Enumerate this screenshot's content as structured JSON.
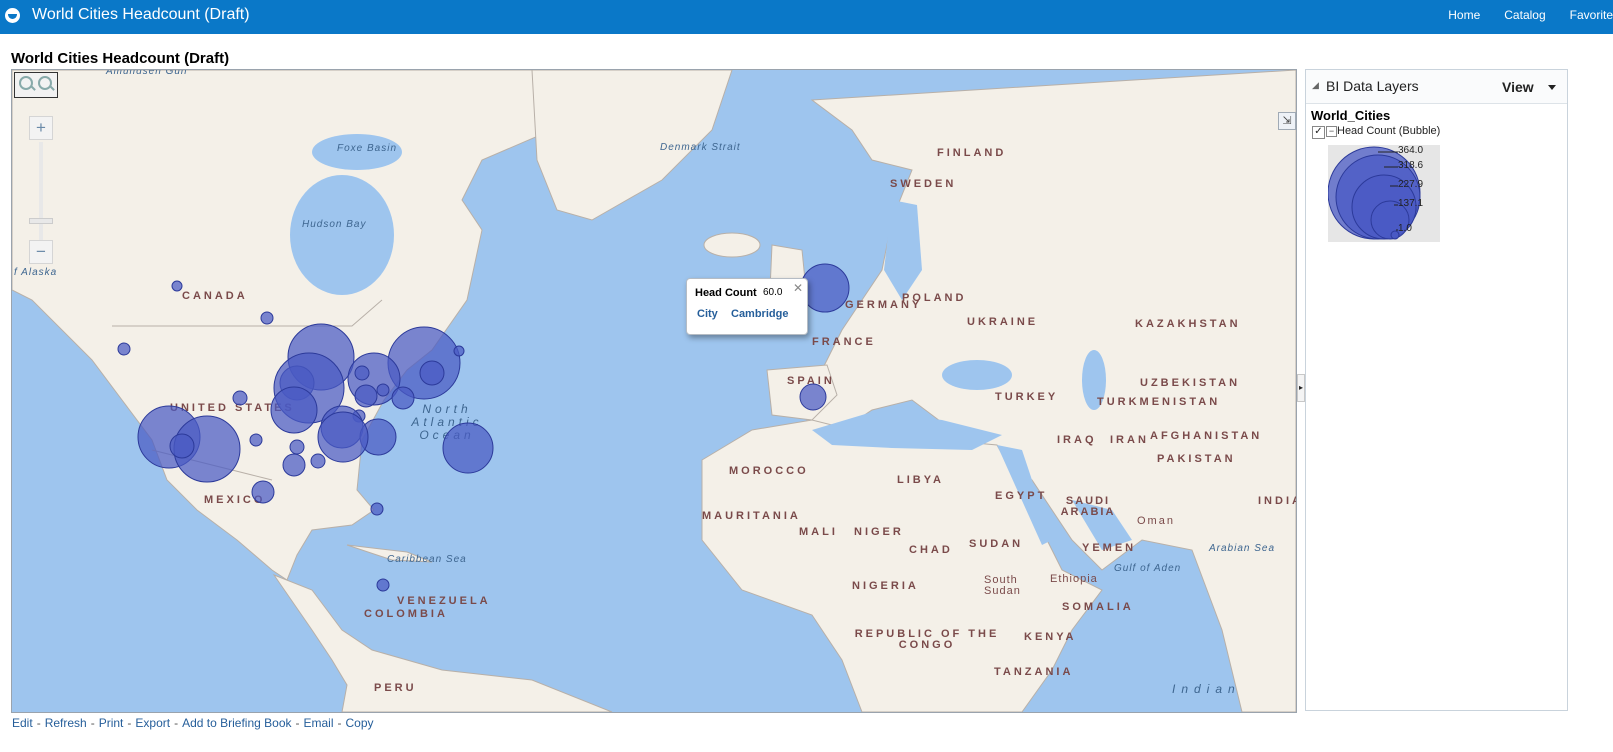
{
  "header": {
    "app_title": "World Cities Headcount (Draft)",
    "nav": [
      "Home",
      "Catalog",
      "Favorite"
    ]
  },
  "page": {
    "title": "World Cities Headcount (Draft)"
  },
  "map": {
    "labels": {
      "canada": "CANADA",
      "usa": "UNITED STATES",
      "mexico": "MEXICO",
      "venezuela": "VENEZUELA",
      "colombia": "COLOMBIA",
      "peru": "PERU",
      "finland": "FINLAND",
      "sweden": "SWEDEN",
      "poland": "POLAND",
      "germany": "GERMANY",
      "france": "FRANCE",
      "ukraine": "UKRAINE",
      "spain": "SPAIN",
      "kazakhstan": "KAZAKHSTAN",
      "uzbekistan": "UZBEKISTAN",
      "turkmenistan": "TURKMENISTAN",
      "turkey": "TURKEY",
      "iraq": "IRAQ",
      "iran": "IRAN",
      "afghanistan": "AFGHANISTAN",
      "pakistan": "PAKISTAN",
      "india": "INDIA",
      "morocco": "MOROCCO",
      "libya": "LIBYA",
      "egypt": "EGYPT",
      "saudi": "SAUDI ARABIA",
      "oman": "Oman",
      "yemen": "YEMEN",
      "mauritania": "MAURITANIA",
      "mali": "MALI",
      "niger": "NIGER",
      "chad": "CHAD",
      "sudan": "SUDAN",
      "south_sudan": "South Sudan",
      "ethiopia": "Ethiopia",
      "somalia": "SOMALIA",
      "nigeria": "NIGERIA",
      "kenya": "KENYA",
      "congo": "REPUBLIC OF THE CONGO",
      "tanzania": "TANZANIA",
      "hudson": "Hudson Bay",
      "foxe": "Foxe Basin",
      "denmark": "Denmark Strait",
      "north_atlantic": "North Atlantic Ocean",
      "caribbean": "Caribbean Sea",
      "arabian": "Arabian Sea",
      "aden": "Gulf of Aden",
      "indian": "Indian",
      "alaska": "f Alaska",
      "amundsen": "Amundsen Gulf"
    },
    "zoom_in_symbol": "+",
    "zoom_out_symbol": "−",
    "overview_symbol": "⇲",
    "tooltip": {
      "measure_label": "Head Count",
      "measure_value": "60.0",
      "city_label": "City",
      "city_value": "Cambridge",
      "close_symbol": "✕"
    }
  },
  "layers_panel": {
    "title": "BI Data Layers",
    "view_label": "View",
    "layer_name": "World_Cities",
    "layer_item": "Head Count (Bubble)",
    "checked": true,
    "legend_values": [
      "364.0",
      "318.6",
      "227.9",
      "137.1",
      "1.0"
    ]
  },
  "footer": {
    "links": [
      "Edit",
      "Refresh",
      "Print",
      "Export",
      "Add to Briefing Book",
      "Email",
      "Copy"
    ]
  },
  "colors": {
    "header_bg": "#0a78c8",
    "ocean": "#9ec5ee",
    "land": "#f4f0e8",
    "bubble_fill": "#4a5ac4",
    "link": "#255e9a"
  }
}
